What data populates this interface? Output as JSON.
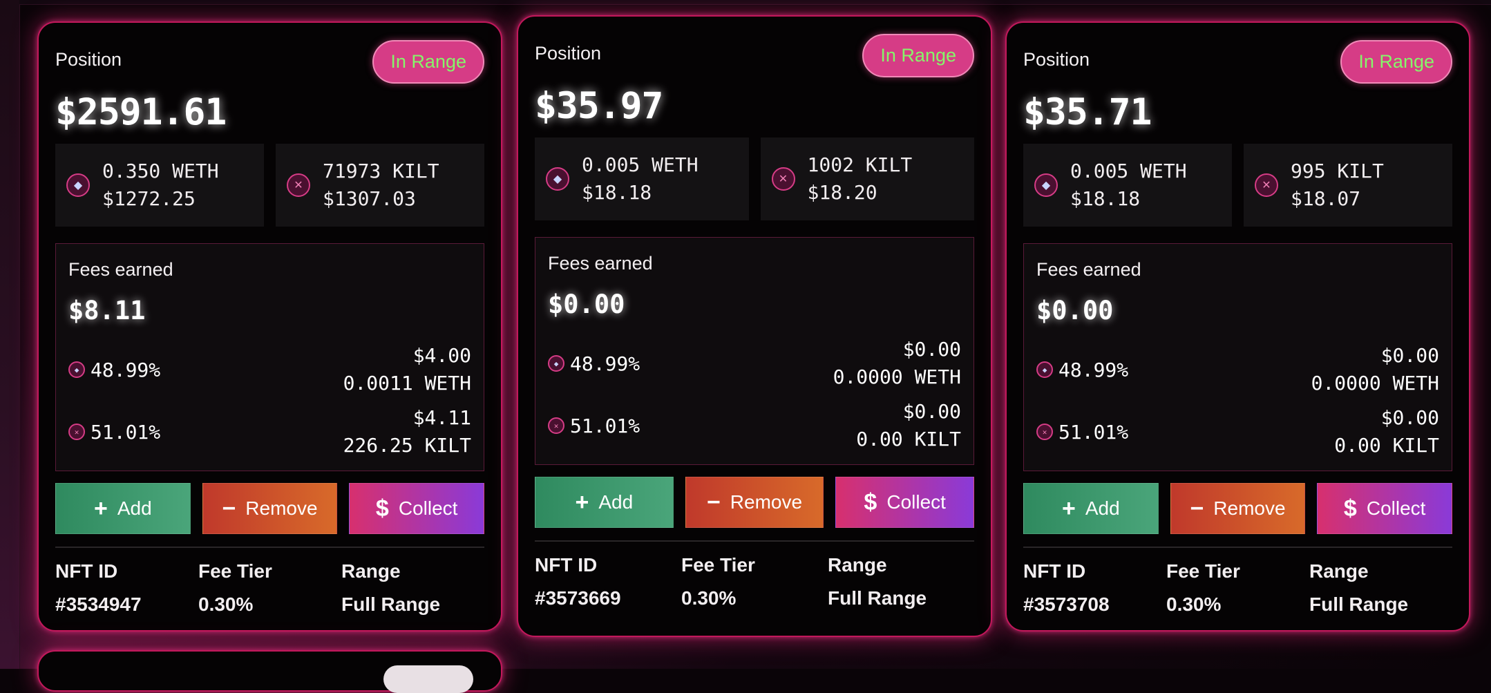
{
  "cards": [
    {
      "position_label": "Position",
      "status": "In Range",
      "value": "$2591.61",
      "tokens": [
        {
          "amount": "0.350 WETH",
          "usd": "$1272.25",
          "icon": "eth-icon"
        },
        {
          "amount": "71973 KILT",
          "usd": "$1307.03",
          "icon": "kilt-icon"
        }
      ],
      "fees": {
        "title": "Fees earned",
        "total": "$8.11",
        "rows": [
          {
            "pct": "48.99%",
            "usd": "$4.00",
            "amount": "0.0011 WETH",
            "icon": "eth-icon"
          },
          {
            "pct": "51.01%",
            "usd": "$4.11",
            "amount": "226.25 KILT",
            "icon": "kilt-icon"
          }
        ]
      },
      "actions": {
        "add": "Add",
        "remove": "Remove",
        "collect": "Collect"
      },
      "meta": {
        "nft_label": "NFT ID",
        "nft_value": "#3534947",
        "fee_label": "Fee Tier",
        "fee_value": "0.30%",
        "range_label": "Range",
        "range_value": "Full Range"
      }
    },
    {
      "position_label": "Position",
      "status": "In Range",
      "value": "$35.97",
      "tokens": [
        {
          "amount": "0.005 WETH",
          "usd": "$18.18",
          "icon": "eth-icon"
        },
        {
          "amount": "1002 KILT",
          "usd": "$18.20",
          "icon": "kilt-icon"
        }
      ],
      "fees": {
        "title": "Fees earned",
        "total": "$0.00",
        "rows": [
          {
            "pct": "48.99%",
            "usd": "$0.00",
            "amount": "0.0000 WETH",
            "icon": "eth-icon"
          },
          {
            "pct": "51.01%",
            "usd": "$0.00",
            "amount": "0.00 KILT",
            "icon": "kilt-icon"
          }
        ]
      },
      "actions": {
        "add": "Add",
        "remove": "Remove",
        "collect": "Collect"
      },
      "meta": {
        "nft_label": "NFT ID",
        "nft_value": "#3573669",
        "fee_label": "Fee Tier",
        "fee_value": "0.30%",
        "range_label": "Range",
        "range_value": "Full Range"
      }
    },
    {
      "position_label": "Position",
      "status": "In Range",
      "value": "$35.71",
      "tokens": [
        {
          "amount": "0.005 WETH",
          "usd": "$18.18",
          "icon": "eth-icon"
        },
        {
          "amount": "995 KILT",
          "usd": "$18.07",
          "icon": "kilt-icon"
        }
      ],
      "fees": {
        "title": "Fees earned",
        "total": "$0.00",
        "rows": [
          {
            "pct": "48.99%",
            "usd": "$0.00",
            "amount": "0.0000 WETH",
            "icon": "eth-icon"
          },
          {
            "pct": "51.01%",
            "usd": "$0.00",
            "amount": "0.00 KILT",
            "icon": "kilt-icon"
          }
        ]
      },
      "actions": {
        "add": "Add",
        "remove": "Remove",
        "collect": "Collect"
      },
      "meta": {
        "nft_label": "NFT ID",
        "nft_value": "#3573708",
        "fee_label": "Fee Tier",
        "fee_value": "0.30%",
        "range_label": "Range",
        "range_value": "Full Range"
      }
    }
  ],
  "symbols": {
    "eth": "◆",
    "kilt": "✕",
    "plus": "+",
    "minus": "−",
    "dollar": "$"
  },
  "colors": {
    "accent": "#d63c86",
    "in_range_text": "#86f56a",
    "add": "#3a9a6c",
    "remove": "#cf4e2b",
    "collect_start": "#d7306e",
    "collect_end": "#8a3ad8"
  }
}
